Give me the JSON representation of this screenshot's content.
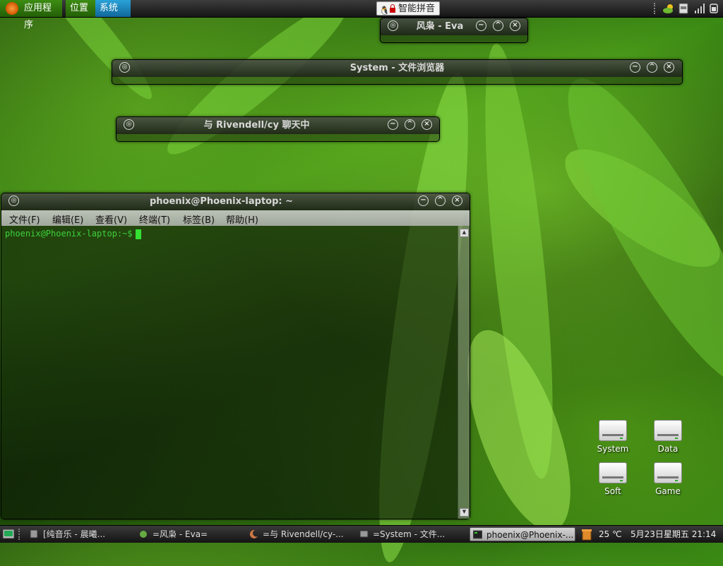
{
  "top_panel": {
    "menus": {
      "applications": "应用程序",
      "places": "位置",
      "system": "系统"
    },
    "ime_label": "智能拼音",
    "tray_icons": [
      "grip-icon",
      "weather-icon",
      "storage-icon",
      "signal-icon",
      "power-icon"
    ]
  },
  "windows": {
    "eva": {
      "title": "风枭 - Eva"
    },
    "file_browser": {
      "title": "System - 文件浏览器"
    },
    "chat": {
      "title": "与 Rivendell/cy 聊天中"
    },
    "terminal": {
      "title": "phoenix@Phoenix-laptop: ~",
      "menu": [
        "文件(F)",
        "编辑(E)",
        "查看(V)",
        "终端(T)",
        "标签(B)",
        "帮助(H)"
      ],
      "prompt": "phoenix@Phoenix-laptop:~$"
    }
  },
  "desktop_icons": [
    {
      "label": "System"
    },
    {
      "label": "Data"
    },
    {
      "label": "Soft"
    },
    {
      "label": "Game"
    }
  ],
  "taskbar": {
    "tasks": [
      {
        "label": "[纯音乐 - 晨曦..."
      },
      {
        "label": "=风枭 - Eva="
      },
      {
        "label": "=与 Rivendell/cy-..."
      },
      {
        "label": "=System - 文件..."
      },
      {
        "label": "phoenix@Phoenix-..."
      }
    ],
    "weather": "25 ℃",
    "clock": "5月23日星期五 21:14"
  },
  "colors": {
    "terminal_text": "#3cd23c",
    "menu_green": "#3d8c13",
    "menu_blue": "#2aa2d8"
  }
}
